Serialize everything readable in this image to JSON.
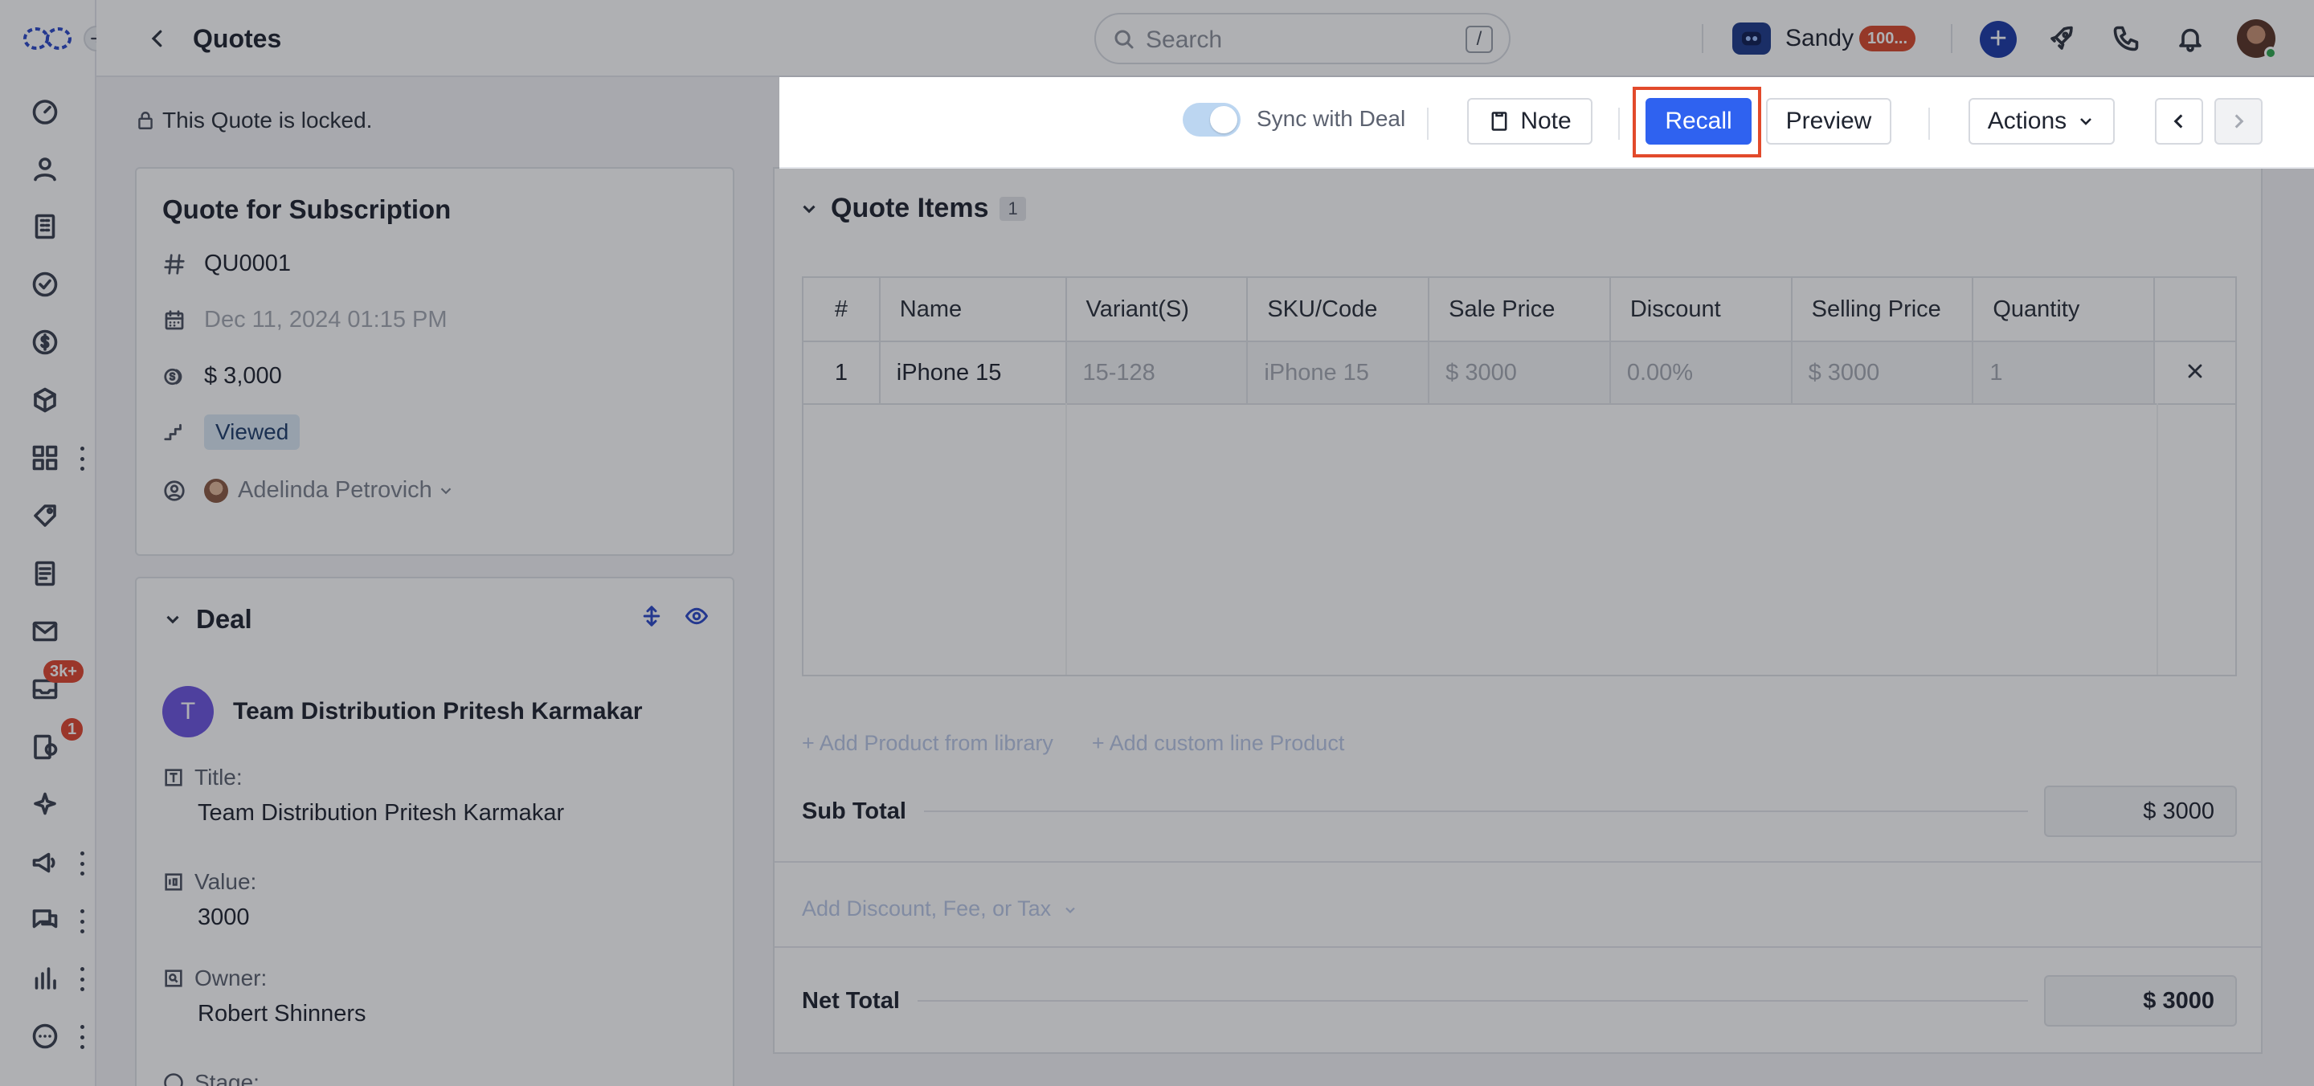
{
  "header": {
    "title": "Quotes",
    "search_placeholder": "Search",
    "search_shortcut": "/",
    "user_name": "Sandy",
    "user_badge": "100..."
  },
  "nav": {
    "badges": {
      "inbox": "3k+",
      "tasks": "1"
    }
  },
  "lock_notice": "This Quote is locked.",
  "quote": {
    "title": "Quote for Subscription",
    "number": "QU0001",
    "date": "Dec 11, 2024 01:15 PM",
    "amount": "$ 3,000",
    "status": "Viewed",
    "owner": "Adelinda Petrovich"
  },
  "deal": {
    "section_title": "Deal",
    "avatar_letter": "T",
    "name": "Team Distribution Pritesh Karmakar",
    "fields": [
      {
        "label": "Title:",
        "value": "Team Distribution Pritesh Karmakar"
      },
      {
        "label": "Value:",
        "value": "3000"
      },
      {
        "label": "Owner:",
        "value": "Robert Shinners"
      },
      {
        "label": "Stage:",
        "value": ""
      }
    ]
  },
  "toolbar": {
    "sync_label": "Sync with Deal",
    "sync_enabled": true,
    "note_label": "Note",
    "recall_label": "Recall",
    "preview_label": "Preview",
    "actions_label": "Actions"
  },
  "quote_items": {
    "title": "Quote Items",
    "count": "1",
    "columns": [
      "#",
      "Name",
      "Variant(S)",
      "SKU/Code",
      "Sale Price",
      "Discount",
      "Selling Price",
      "Quantity"
    ],
    "rows": [
      {
        "num": "1",
        "name": "iPhone 15",
        "variant": "15-128",
        "sku": "iPhone 15",
        "sale_price": "$ 3000",
        "discount": "0.00%",
        "selling_price": "$ 3000",
        "quantity": "1"
      }
    ],
    "add_library": "Add Product from library",
    "add_custom": "Add custom line Product",
    "subtotal_label": "Sub Total",
    "subtotal_value": "$ 3000",
    "discount_link": "Add Discount, Fee, or Tax",
    "net_total_label": "Net Total",
    "net_total_value": "$ 3000"
  },
  "colors": {
    "primary": "#2f62f0",
    "highlight": "#e24a2b",
    "viewed_tag": "#dbe8f5",
    "overlay": "rgba(20,24,33,0.34)"
  }
}
